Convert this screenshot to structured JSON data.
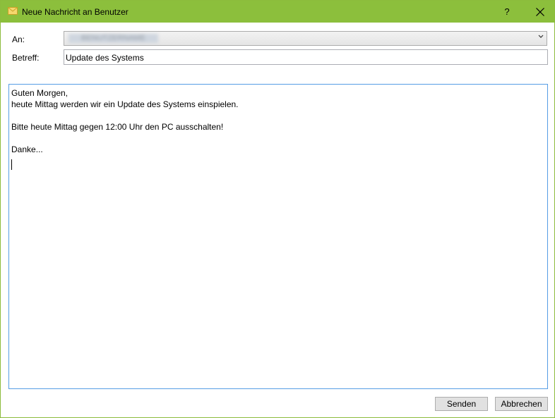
{
  "window": {
    "title": "Neue Nachricht an Benutzer",
    "help_label": "?",
    "accent_color": "#8cbf3c"
  },
  "form": {
    "to_label": "An:",
    "to_value": "BENUTZERNAME",
    "subject_label": "Betreff:",
    "subject_value": "Update des Systems"
  },
  "message": {
    "lines": [
      "Guten Morgen,",
      "heute Mittag werden wir ein Update des Systems einspielen.",
      "",
      "Bitte heute Mittag gegen 12:00 Uhr den PC ausschalten!",
      "",
      "Danke..."
    ]
  },
  "buttons": {
    "send_label": "Senden",
    "cancel_label": "Abbrechen"
  },
  "icons": {
    "title": "envelope-icon",
    "close": "close-icon",
    "dropdown": "chevron-down-icon"
  }
}
